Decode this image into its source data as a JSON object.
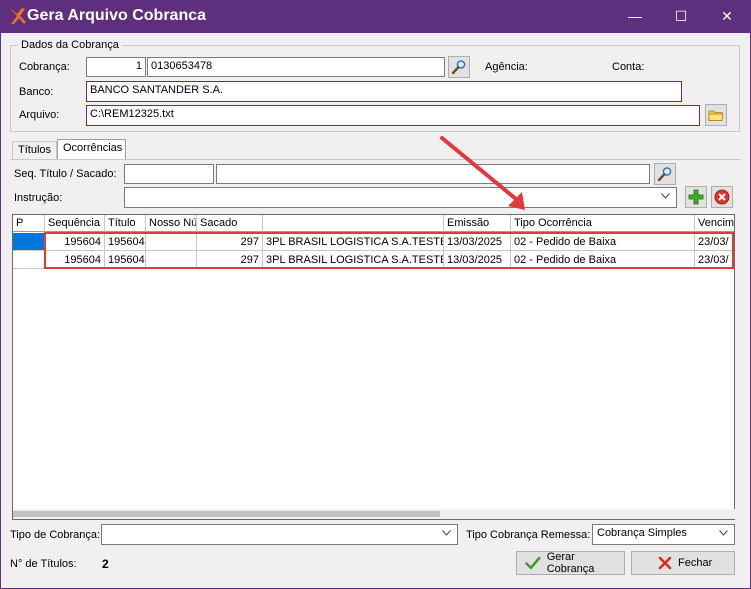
{
  "window": {
    "title": "Gera Arquivo Cobranca",
    "controls": {
      "minimize": "—",
      "maximize": "☐",
      "close": "✕"
    }
  },
  "dados": {
    "group_title": "Dados da Cobrança",
    "cobranca_label": "Cobrança:",
    "cobranca_code": "1",
    "cobranca_number": "0130653478",
    "agencia_label": "Agência:",
    "conta_label": "Conta:",
    "banco_label": "Banco:",
    "banco_value": "BANCO SANTANDER S.A.",
    "arquivo_label": "Arquivo:",
    "arquivo_value": "C:\\REM12325.txt"
  },
  "tabs": [
    {
      "label": "Títulos",
      "active": false
    },
    {
      "label": "Ocorrências",
      "active": true
    }
  ],
  "ocorrencias": {
    "seq_label": "Seq. Título / Sacado:",
    "seq_value": "",
    "sacado_value": "",
    "instrucao_label": "Instrução:",
    "instrucao_value": ""
  },
  "grid": {
    "columns": [
      "P",
      "Sequência",
      "Título",
      "Nosso Nú",
      "Sacado",
      "",
      "Emissão",
      "Tipo Ocorrência",
      "Vencim"
    ],
    "rows": [
      {
        "seq": "195604",
        "titulo": "195604",
        "nosso": "",
        "sacado_cod": "297",
        "sacado_nome": "3PL BRASIL LOGISTICA S.A.TESTE",
        "emissao": "13/03/2025",
        "tipo": "02 - Pedido de Baixa",
        "venc": "23/03/"
      },
      {
        "seq": "195604",
        "titulo": "195604",
        "nosso": "",
        "sacado_cod": "297",
        "sacado_nome": "3PL BRASIL LOGISTICA S.A.TESTE",
        "emissao": "13/03/2025",
        "tipo": "02 - Pedido de Baixa",
        "venc": "23/03/"
      }
    ]
  },
  "footer": {
    "tipo_cobranca_label": "Tipo de Cobrança:",
    "tipo_cobranca_value": "",
    "tipo_remessa_label": "Tipo Cobrança Remessa:",
    "tipo_remessa_value": "Cobrança Simples",
    "ntitulos_label": "N° de Títulos:",
    "ntitulos_value": "2",
    "gerar_label": "Gerar Cobrança",
    "fechar_label": "Fechar"
  },
  "colors": {
    "titlebar": "#5e2f7c",
    "selection": "#0078d7",
    "highlight": "#e03b3b"
  }
}
